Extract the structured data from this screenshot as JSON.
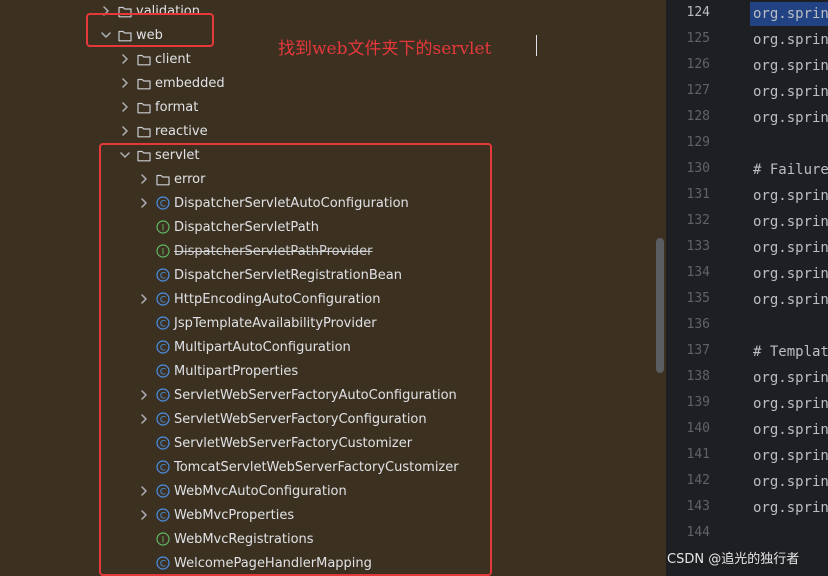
{
  "tree": {
    "items": [
      {
        "label": "validation",
        "type": "folder",
        "chevron": "right"
      },
      {
        "label": "web",
        "type": "folder",
        "chevron": "down"
      },
      {
        "label": "client",
        "type": "folder",
        "chevron": "right"
      },
      {
        "label": "embedded",
        "type": "folder",
        "chevron": "right"
      },
      {
        "label": "format",
        "type": "folder",
        "chevron": "right"
      },
      {
        "label": "reactive",
        "type": "folder",
        "chevron": "right"
      },
      {
        "label": "servlet",
        "type": "folder",
        "chevron": "down"
      },
      {
        "label": "error",
        "type": "folder",
        "chevron": "right"
      },
      {
        "label": "DispatcherServletAutoConfiguration",
        "type": "class",
        "chevron": "right"
      },
      {
        "label": "DispatcherServletPath",
        "type": "interface",
        "chevron": ""
      },
      {
        "label": "DispatcherServletPathProvider",
        "type": "interface",
        "chevron": "",
        "deprecated": true
      },
      {
        "label": "DispatcherServletRegistrationBean",
        "type": "class",
        "chevron": ""
      },
      {
        "label": "HttpEncodingAutoConfiguration",
        "type": "class",
        "chevron": "right"
      },
      {
        "label": "JspTemplateAvailabilityProvider",
        "type": "class",
        "chevron": ""
      },
      {
        "label": "MultipartAutoConfiguration",
        "type": "class",
        "chevron": ""
      },
      {
        "label": "MultipartProperties",
        "type": "class",
        "chevron": ""
      },
      {
        "label": "ServletWebServerFactoryAutoConfiguration",
        "type": "class",
        "chevron": "right"
      },
      {
        "label": "ServletWebServerFactoryConfiguration",
        "type": "class",
        "chevron": "right"
      },
      {
        "label": "ServletWebServerFactoryCustomizer",
        "type": "class",
        "chevron": ""
      },
      {
        "label": "TomcatServletWebServerFactoryCustomizer",
        "type": "class",
        "chevron": ""
      },
      {
        "label": "WebMvcAutoConfiguration",
        "type": "class",
        "chevron": "right"
      },
      {
        "label": "WebMvcProperties",
        "type": "class",
        "chevron": "right"
      },
      {
        "label": "WebMvcRegistrations",
        "type": "interface",
        "chevron": ""
      },
      {
        "label": "WelcomePageHandlerMapping",
        "type": "class",
        "chevron": ""
      }
    ]
  },
  "annotation": {
    "text": "找到web文件夹下的servlet"
  },
  "editor": {
    "current_line": "124",
    "lines": [
      {
        "no": "124",
        "text": "org.sprin"
      },
      {
        "no": "125",
        "text": "org.sprin"
      },
      {
        "no": "126",
        "text": "org.sprin"
      },
      {
        "no": "127",
        "text": "org.sprin"
      },
      {
        "no": "128",
        "text": "org.sprin"
      },
      {
        "no": "129",
        "text": ""
      },
      {
        "no": "130",
        "text": "# Failure"
      },
      {
        "no": "131",
        "text": "org.sprin"
      },
      {
        "no": "132",
        "text": "org.sprin"
      },
      {
        "no": "133",
        "text": "org.sprin"
      },
      {
        "no": "134",
        "text": "org.sprin"
      },
      {
        "no": "135",
        "text": "org.sprin"
      },
      {
        "no": "136",
        "text": ""
      },
      {
        "no": "137",
        "text": "# Templat"
      },
      {
        "no": "138",
        "text": "org.sprin"
      },
      {
        "no": "139",
        "text": "org.sprin"
      },
      {
        "no": "140",
        "text": "org.sprin"
      },
      {
        "no": "141",
        "text": "org.sprin"
      },
      {
        "no": "142",
        "text": "org.sprin"
      },
      {
        "no": "143",
        "text": "org.sprin"
      },
      {
        "no": "144",
        "text": ""
      }
    ]
  },
  "watermark": {
    "text": "CSDN @追光的独行者"
  },
  "colors": {
    "highlight": "#e5383b",
    "class_icon": "#4d8fe8",
    "interface_icon": "#5fb865"
  }
}
